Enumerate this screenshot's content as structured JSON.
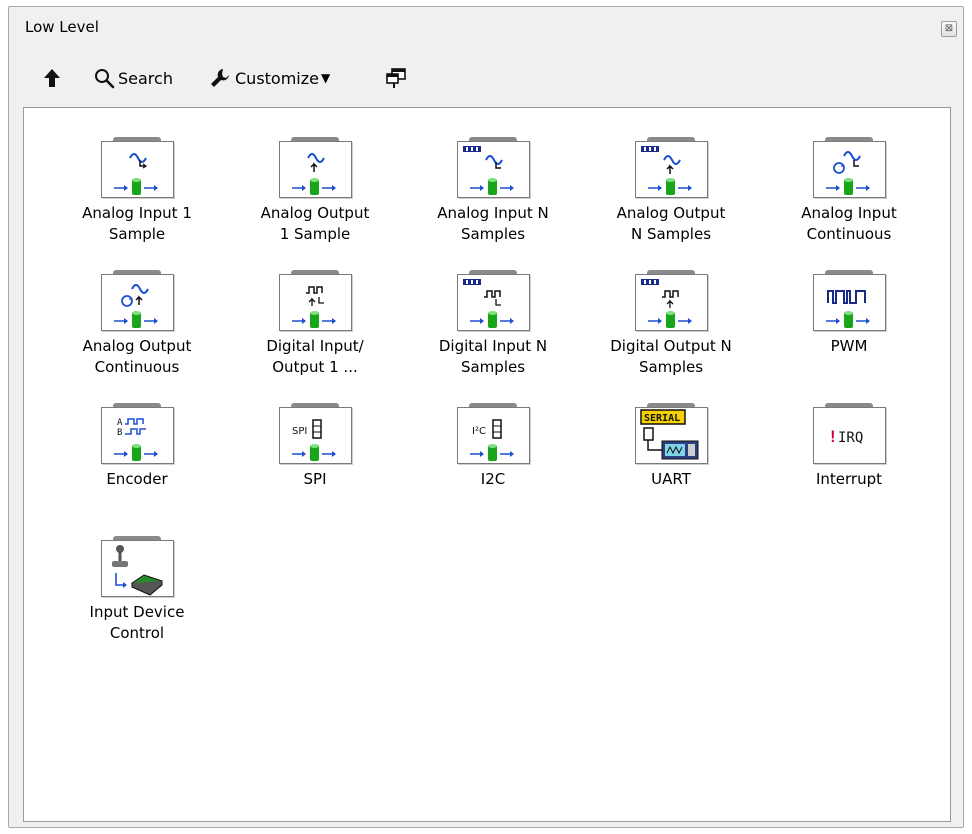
{
  "window": {
    "title": "Low Level",
    "close_glyph": "⊠"
  },
  "toolbar": {
    "up_icon": "up-arrow-icon",
    "search_label": "Search",
    "customize_label": "Customize",
    "customize_caret": "▼",
    "restore_icon": "restore-palette-icon"
  },
  "items": [
    {
      "label1": "Analog Input 1",
      "label2": "Sample"
    },
    {
      "label1": "Analog Output",
      "label2": "1 Sample"
    },
    {
      "label1": "Analog Input N",
      "label2": "Samples"
    },
    {
      "label1": "Analog Output",
      "label2": "N Samples"
    },
    {
      "label1": "Analog Input",
      "label2": "Continuous"
    },
    {
      "label1": "Analog Output",
      "label2": "Continuous"
    },
    {
      "label1": "Digital Input/",
      "label2": "Output 1 ..."
    },
    {
      "label1": "Digital Input N",
      "label2": "Samples"
    },
    {
      "label1": "Digital Output N",
      "label2": "Samples"
    },
    {
      "label1": "PWM",
      "label2": ""
    },
    {
      "label1": "Encoder",
      "label2": ""
    },
    {
      "label1": "SPI",
      "label2": ""
    },
    {
      "label1": "I2C",
      "label2": ""
    },
    {
      "label1": "UART",
      "label2": ""
    },
    {
      "label1": "Interrupt",
      "label2": ""
    },
    {
      "label1": "Input Device",
      "label2": "Control"
    }
  ],
  "icon_text": {
    "spi": "SPI",
    "i2c": "I²C",
    "serial": "SERIAL",
    "irq_bang": "!",
    "irq": "IRQ",
    "encoder_a": "A",
    "encoder_b": "B"
  },
  "colors": {
    "accent_blue": "#1a4fd0",
    "cylinder_green": "#19a519",
    "warning_red": "#d4003a",
    "serial_yellow": "#f5d000"
  }
}
